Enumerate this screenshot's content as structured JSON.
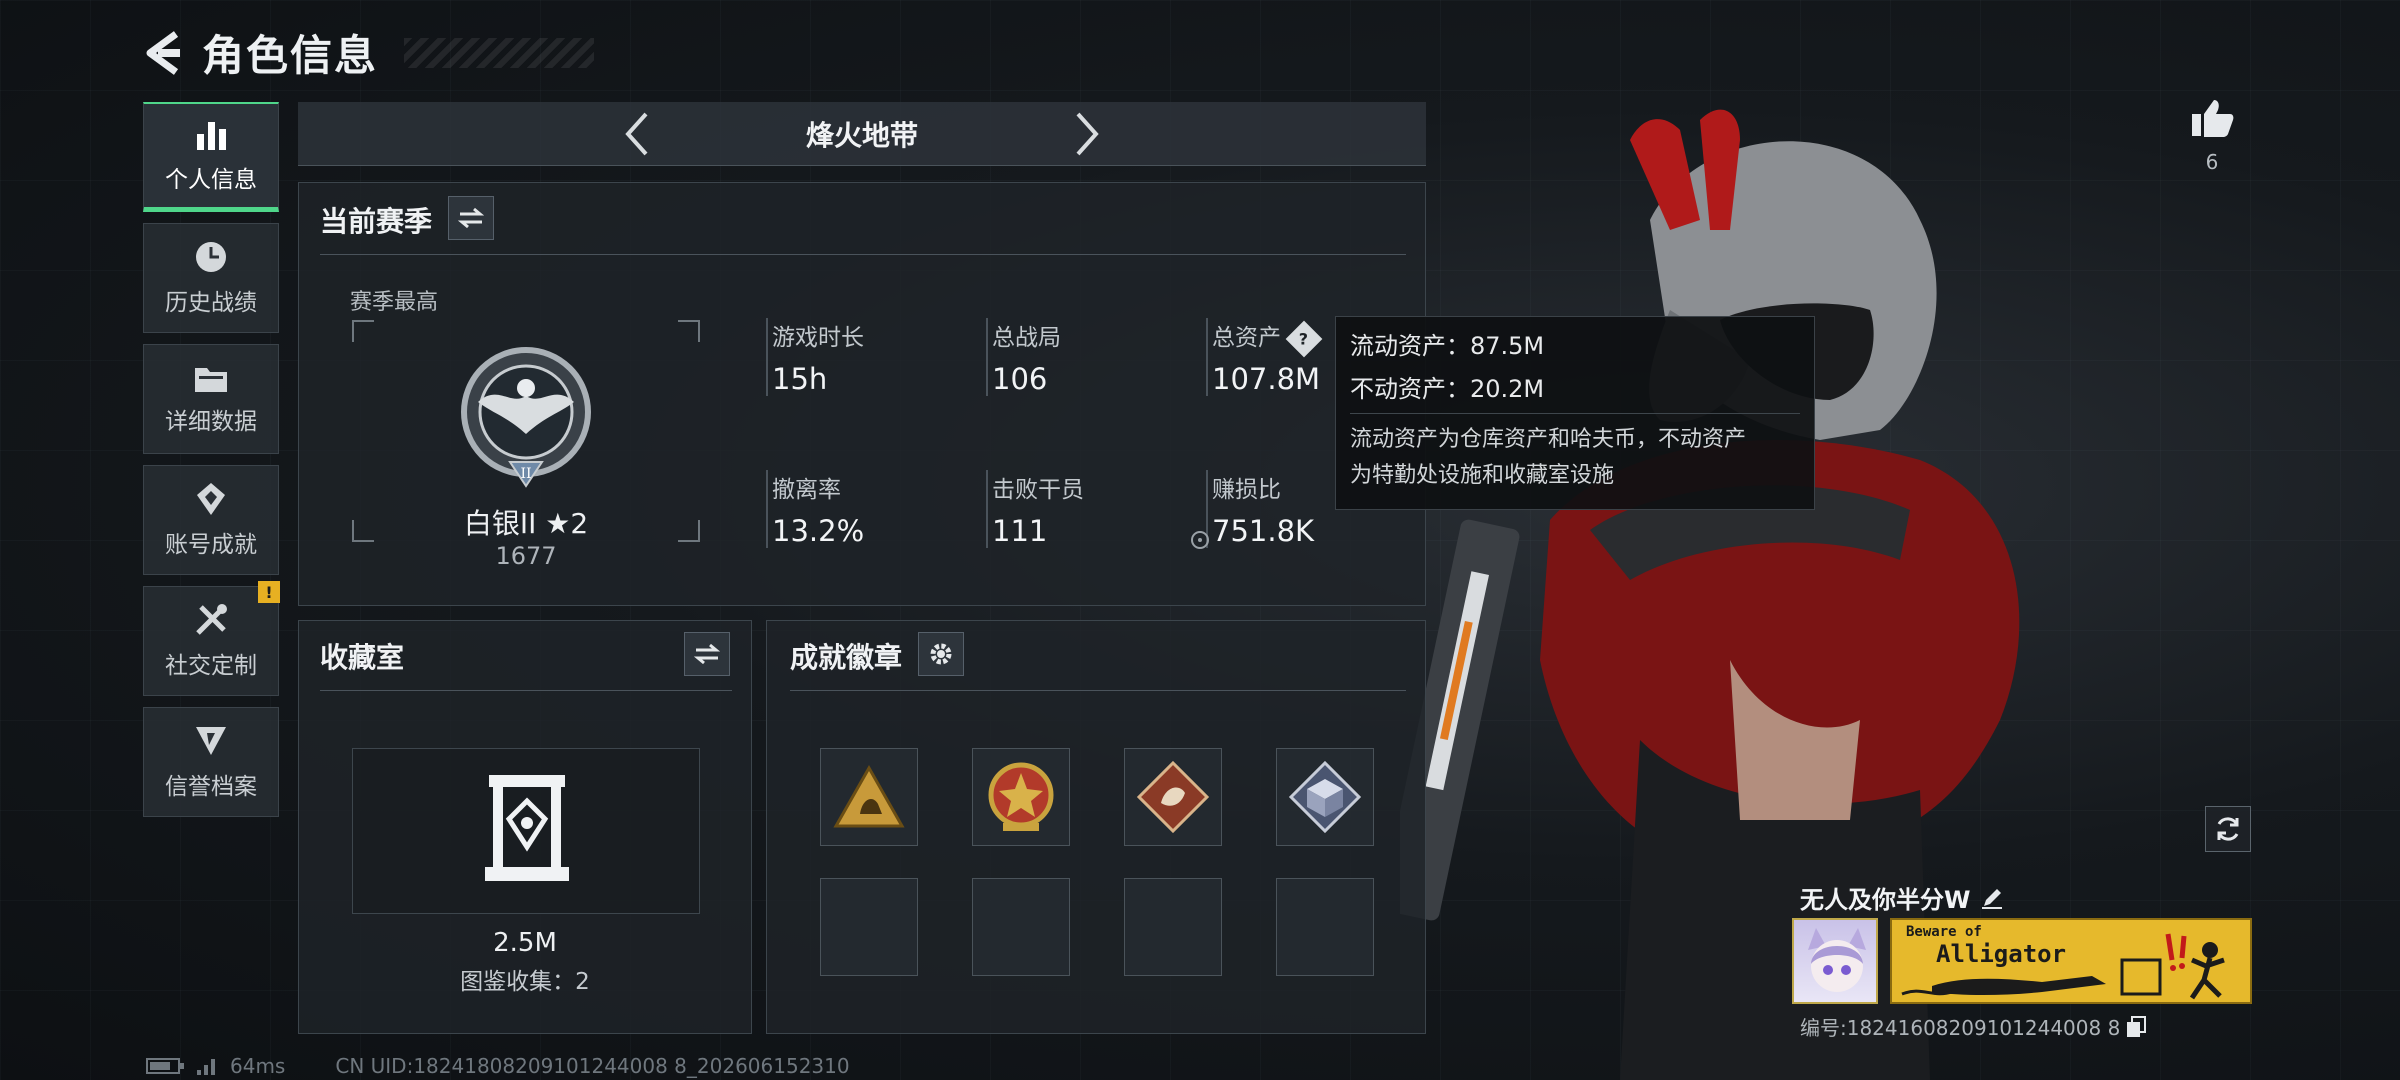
{
  "header": {
    "title": "角色信息"
  },
  "sidebar": {
    "items": [
      {
        "label": "个人信息",
        "icon": "bar-chart-icon",
        "active": true
      },
      {
        "label": "历史战绩",
        "icon": "clock-icon"
      },
      {
        "label": "详细数据",
        "icon": "folder-icon"
      },
      {
        "label": "账号成就",
        "icon": "achievement-icon"
      },
      {
        "label": "社交定制",
        "icon": "tools-icon",
        "badge": "!"
      },
      {
        "label": "信誉档案",
        "icon": "credit-icon"
      }
    ]
  },
  "mode": {
    "name": "烽火地带"
  },
  "season": {
    "title": "当前赛季",
    "best_label": "赛季最高",
    "rank_name": "白银II ★2",
    "rank_points": "1677",
    "stats": [
      {
        "label": "游戏时长",
        "value": "15h"
      },
      {
        "label": "总战局",
        "value": "106"
      },
      {
        "label": "总资产",
        "value": "107.8M"
      },
      {
        "label": "撤离率",
        "value": "13.2%"
      },
      {
        "label": "击败干员",
        "value": "111"
      },
      {
        "label": "赚损比",
        "value": "751.8K"
      }
    ]
  },
  "tooltip": {
    "liquid": "流动资产：87.5M",
    "fixed": "不动资产：20.2M",
    "desc_1": "流动资产为仓库资产和哈夫币，不动资产",
    "desc_2": "为特勤处设施和收藏室设施"
  },
  "collection": {
    "title": "收藏室",
    "value": "2.5M",
    "count": "图鉴收集：2"
  },
  "badges": {
    "title": "成就徽章",
    "slots": [
      "badge-triangle",
      "badge-star",
      "badge-diamond-red",
      "badge-cube",
      "",
      "",
      "",
      ""
    ]
  },
  "profile": {
    "like_count": "6",
    "name": "无人及你半分W",
    "banner_sub": "Beware of",
    "banner_main": "Alligator",
    "player_id": "编号:18241608209101244008 8"
  },
  "status": {
    "latency": "64ms",
    "uid": "CN UID:18241808209101244008 8_202606152310"
  },
  "colors": {
    "accent_green": "#4fd68a",
    "warning_yellow": "#e7b022",
    "banner_yellow": "#e6b92c"
  }
}
